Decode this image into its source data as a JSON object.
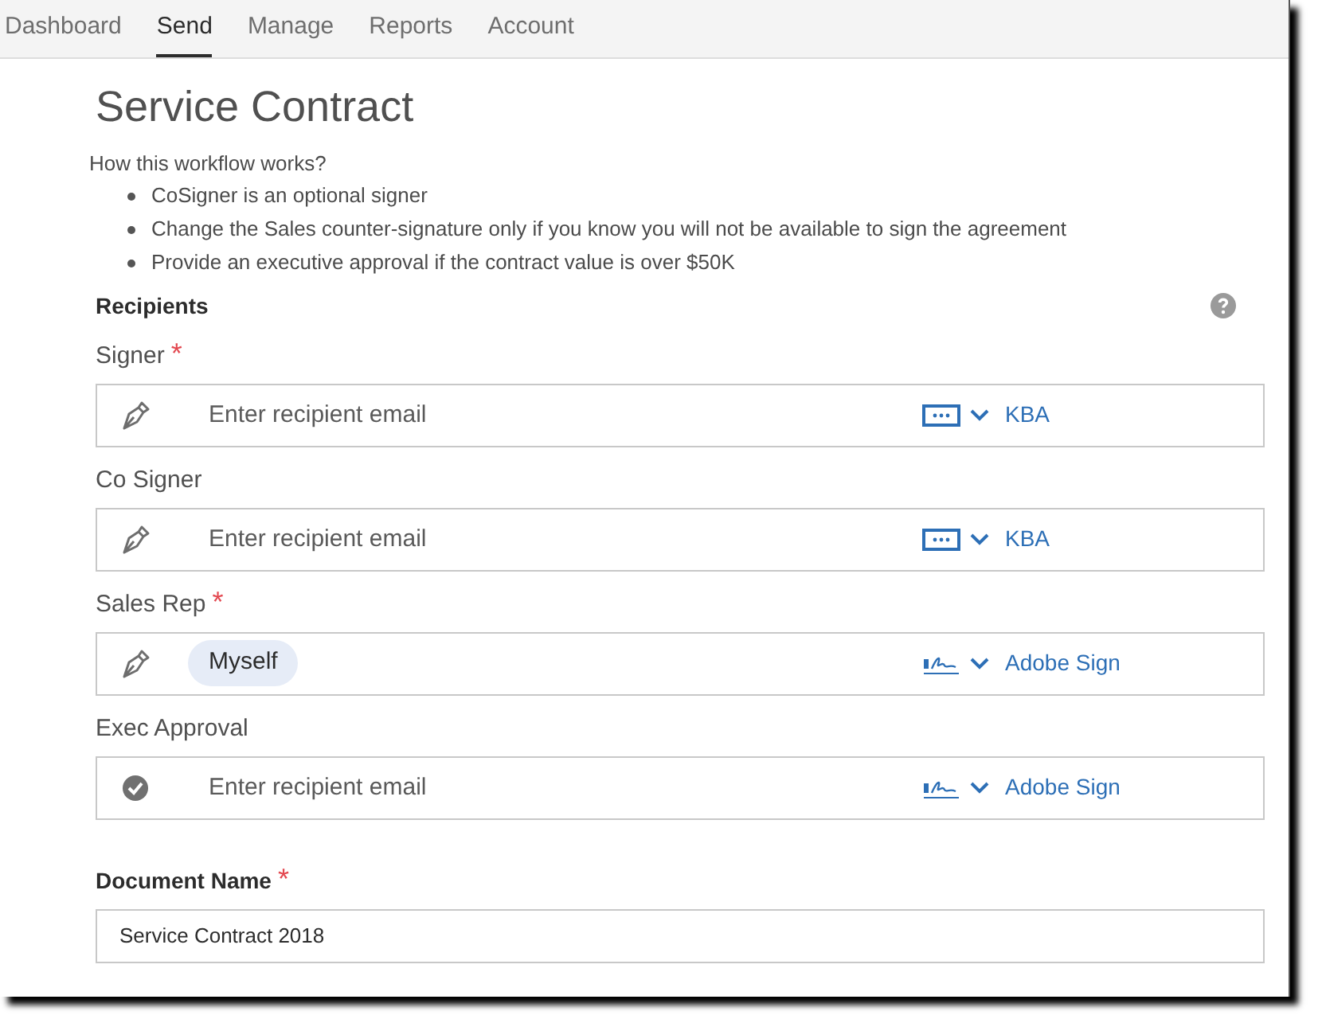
{
  "tabs": [
    {
      "label": "Dashboard",
      "selected": false
    },
    {
      "label": "Send",
      "selected": true
    },
    {
      "label": "Manage",
      "selected": false
    },
    {
      "label": "Reports",
      "selected": false
    },
    {
      "label": "Account",
      "selected": false
    }
  ],
  "title": "Service Contract",
  "instructions": {
    "heading": "How this workflow works?",
    "items": [
      "CoSigner is an optional signer",
      "Change the Sales counter-signature only if you know you will not be available to sign the agreement",
      "Provide an executive approval if the contract value is over $50K"
    ]
  },
  "recipients": {
    "heading": "Recipients",
    "fields": [
      {
        "label": "Signer",
        "required_mark": "*",
        "kind": "signer",
        "placeholder": "Enter recipient email",
        "auth": {
          "kind": "kba",
          "label": "KBA"
        }
      },
      {
        "label": "Co Signer",
        "kind": "signer",
        "placeholder": "Enter recipient email",
        "auth": {
          "kind": "kba",
          "label": "KBA"
        }
      },
      {
        "label": "Sales Rep",
        "required_mark": "*",
        "kind": "signer",
        "chip": "Myself",
        "auth": {
          "kind": "sign",
          "label": "Adobe Sign"
        }
      },
      {
        "label": "Exec Approval",
        "kind": "approver",
        "placeholder": "Enter recipient email",
        "auth": {
          "kind": "sign",
          "label": "Adobe Sign"
        }
      }
    ]
  },
  "document_name": {
    "label": "Document Name",
    "required_mark": "*",
    "value": "Service Contract 2018"
  }
}
